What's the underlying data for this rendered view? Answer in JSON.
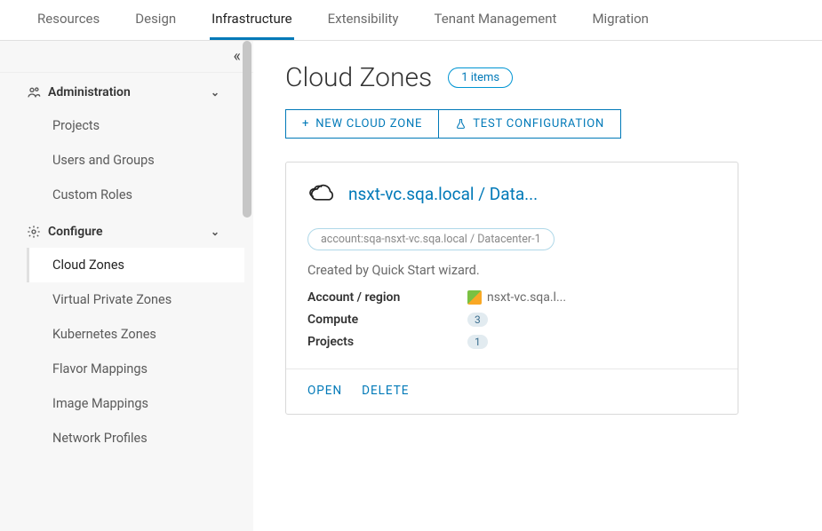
{
  "tabs": {
    "items": [
      "Resources",
      "Design",
      "Infrastructure",
      "Extensibility",
      "Tenant Management",
      "Migration"
    ],
    "active": "Infrastructure"
  },
  "sidebar": {
    "sections": [
      {
        "label": "Administration",
        "icon": "users-icon",
        "items": [
          "Projects",
          "Users and Groups",
          "Custom Roles"
        ]
      },
      {
        "label": "Configure",
        "icon": "gear-icon",
        "items": [
          "Cloud Zones",
          "Virtual Private Zones",
          "Kubernetes Zones",
          "Flavor Mappings",
          "Image Mappings",
          "Network Profiles"
        ],
        "active": "Cloud Zones"
      }
    ]
  },
  "page": {
    "title": "Cloud Zones",
    "item_count_label": "1 items",
    "actions": {
      "new": "NEW CLOUD ZONE",
      "test": "TEST CONFIGURATION"
    }
  },
  "card": {
    "title": "nsxt-vc.sqa.local / Data...",
    "tag": "account:sqa-nsxt-vc.sqa.local / Datacenter-1",
    "description": "Created by Quick Start wizard.",
    "labels": {
      "account_region": "Account / region",
      "compute": "Compute",
      "projects": "Projects"
    },
    "values": {
      "account_region": "nsxt-vc.sqa.l...",
      "compute": "3",
      "projects": "1"
    },
    "actions": {
      "open": "OPEN",
      "delete": "DELETE"
    }
  }
}
